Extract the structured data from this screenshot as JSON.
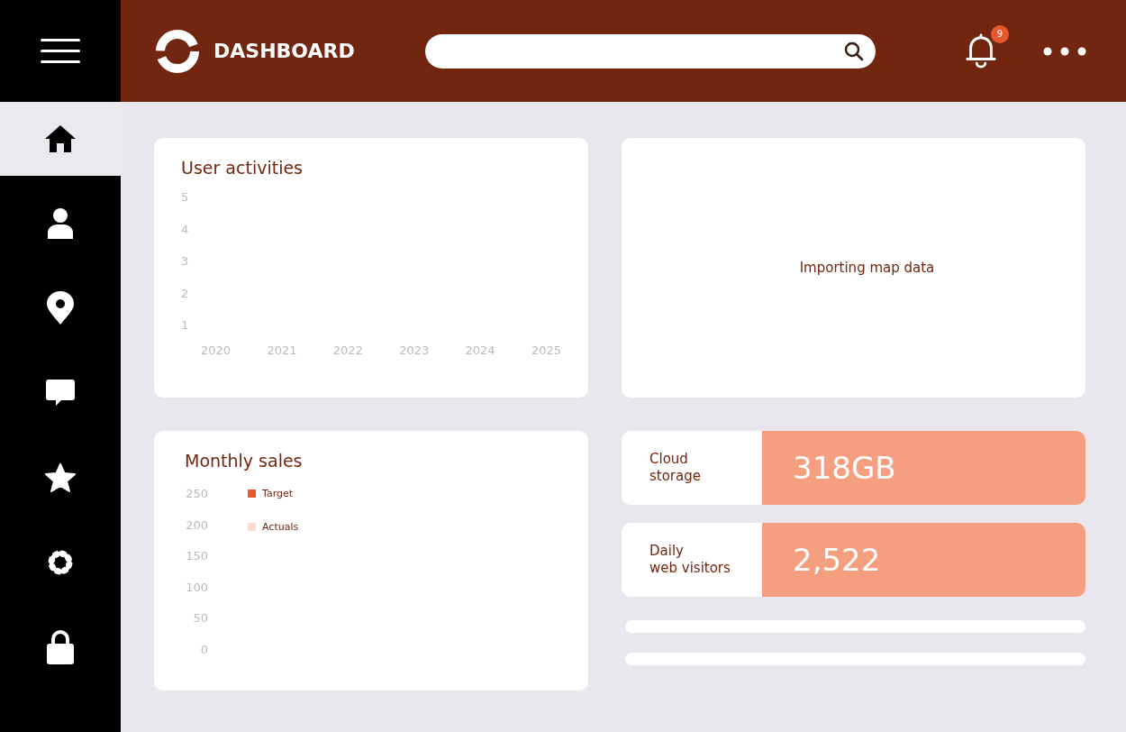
{
  "header": {
    "title": "DASHBOARD",
    "notifications": {
      "count": "9"
    }
  },
  "sidebar": {
    "items": [
      {
        "kind": "home",
        "selected": true
      },
      {
        "kind": "user",
        "selected": false
      },
      {
        "kind": "location",
        "selected": false
      },
      {
        "kind": "chat",
        "selected": false
      },
      {
        "kind": "star",
        "selected": false
      },
      {
        "kind": "settings",
        "selected": false
      },
      {
        "kind": "lock",
        "selected": false
      }
    ]
  },
  "user_activities": {
    "title": "User activities",
    "y_ticks": [
      "5",
      "4",
      "3",
      "2",
      "1"
    ],
    "x_labels": [
      "2020",
      "2021",
      "2022",
      "2023",
      "2024",
      "2025"
    ]
  },
  "map": {
    "status": "Importing map data"
  },
  "monthly_sales": {
    "title": "Monthly sales",
    "y_ticks": [
      "250",
      "200",
      "150",
      "100",
      "50",
      "0"
    ],
    "legend": [
      {
        "label": "Target",
        "color": "#e8582e"
      },
      {
        "label": "Actuals",
        "color": "#fadbd0"
      }
    ]
  },
  "stats": [
    {
      "label": "Cloud\nstorage",
      "value": "318GB"
    },
    {
      "label": "Daily\nweb visitors",
      "value": "2,522"
    }
  ]
}
